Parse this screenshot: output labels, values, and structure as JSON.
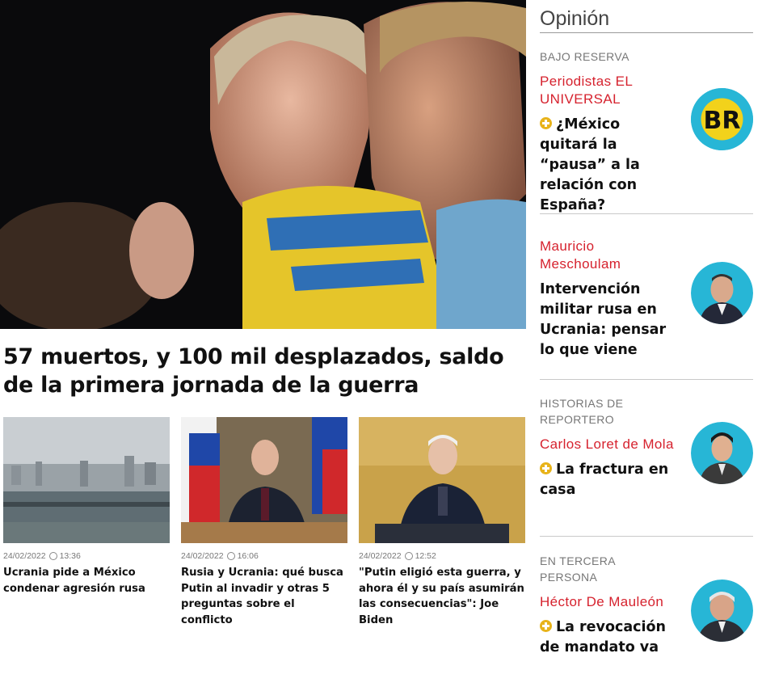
{
  "hero": {
    "image_alt": "Mujeres con bandera de Ucrania lloran",
    "title": "57 muertos, y 100 mil desplazados, saldo de la primera jornada de la guerra"
  },
  "cards": [
    {
      "date": "24/02/2022",
      "time": "13:36",
      "headline": "Ucrania pide a México condenar agresión rusa",
      "image": "kyiv-skyline-image"
    },
    {
      "date": "24/02/2022",
      "time": "16:06",
      "headline": "Rusia y Ucrania: qué busca Putin al invadir y otras 5 preguntas sobre el conflicto",
      "image": "putin-address-image"
    },
    {
      "date": "24/02/2022",
      "time": "12:52",
      "headline": "\"Putin eligió esta guerra, y ahora él y su país asumirán las consecuencias\": Joe Biden",
      "image": "biden-podium-image"
    }
  ],
  "opinion": {
    "title": "Opinión",
    "items": [
      {
        "section": "BAJO RESERVA",
        "author": "Periodistas EL UNIVERSAL",
        "headline": "¿México quitará la “pausa” a la relación con España?",
        "plus": true,
        "avatar_text": "BR"
      },
      {
        "section": "",
        "author": "Mauricio Meschoulam",
        "headline": "Intervención militar rusa en Ucrania: pensar lo que viene",
        "plus": false
      },
      {
        "section": "HISTORIAS DE REPORTERO",
        "author": "Carlos Loret de Mola",
        "headline": "La fractura en casa",
        "plus": true
      },
      {
        "section": "EN TERCERA PERSONA",
        "author": "Héctor De Mauleón",
        "headline": "La revocación de mandato va",
        "plus": true
      }
    ]
  },
  "colors": {
    "author_red": "#d6222e",
    "plus_yellow": "#e8b31a",
    "avatar_cyan": "#27b6d6"
  }
}
